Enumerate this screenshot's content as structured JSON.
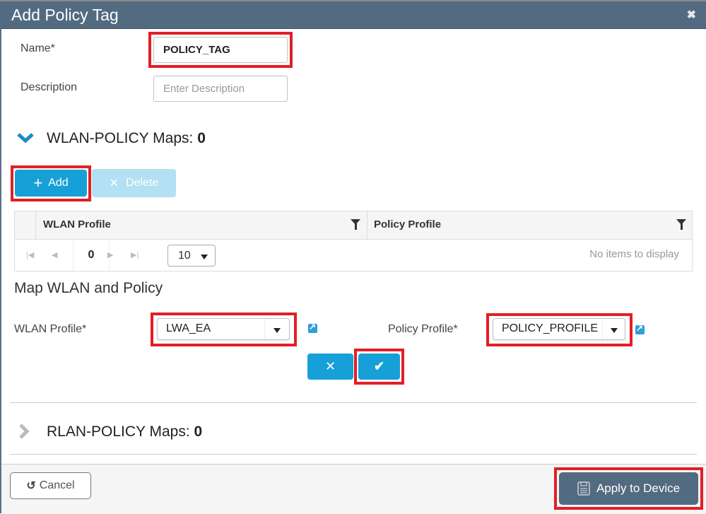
{
  "dialog": {
    "title": "Add Policy Tag",
    "close_icon": "close-icon"
  },
  "form": {
    "name_label": "Name*",
    "name_value": "POLICY_TAG",
    "description_label": "Description",
    "description_placeholder": "Enter Description"
  },
  "wlan_section": {
    "title": "WLAN-POLICY Maps:",
    "count": "0",
    "expanded": true,
    "add_label": "Add",
    "delete_label": "Delete",
    "table": {
      "columns": [
        "WLAN Profile",
        "Policy Profile"
      ],
      "rows": [],
      "page_number": "0",
      "page_size": "10",
      "empty_message": "No items to display"
    }
  },
  "map_section": {
    "title": "Map WLAN and Policy",
    "wlan_profile_label": "WLAN Profile*",
    "wlan_profile_value": "LWA_EA",
    "policy_profile_label": "Policy Profile*",
    "policy_profile_value": "POLICY_PROFILE"
  },
  "rlan_section": {
    "title": "RLAN-POLICY Maps:",
    "count": "0",
    "expanded": false
  },
  "footer": {
    "cancel_label": "Cancel",
    "apply_label": "Apply to Device"
  },
  "colors": {
    "header": "#536b80",
    "primary": "#17a0d8",
    "highlight": "#e21f26"
  }
}
